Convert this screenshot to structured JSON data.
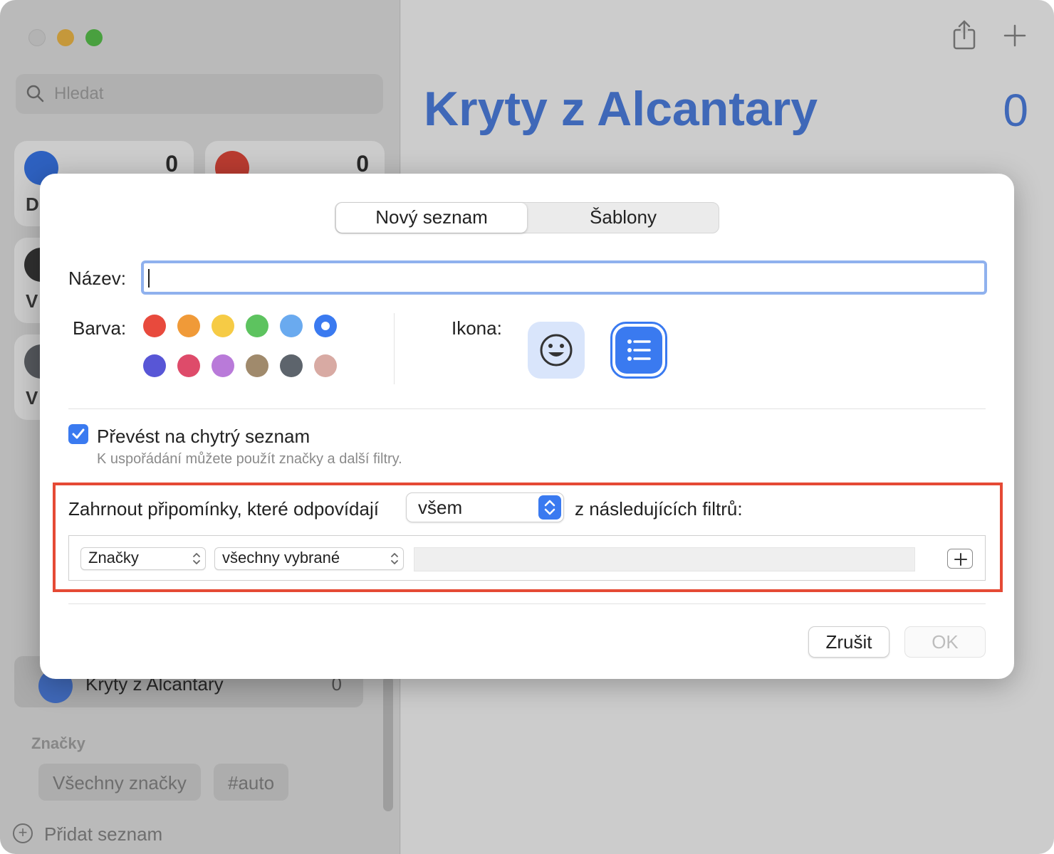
{
  "sidebar": {
    "search_placeholder": "Hledat",
    "tiles": [
      {
        "label": "D",
        "count": "0",
        "icon": "calendar-today-icon"
      },
      {
        "label": "",
        "count": "0",
        "icon": "calendar-scheduled-icon"
      },
      {
        "label": "V",
        "count": "",
        "icon": "tray-all-icon"
      },
      {
        "label": "V",
        "count": "",
        "icon": "checkmark-completed-icon"
      }
    ],
    "selected_list": {
      "label": "Kryty z Alcantary",
      "count": "0",
      "icon": "list-icon"
    },
    "tags_header": "Značky",
    "tags": [
      "Všechny značky",
      "#auto"
    ],
    "add_list_label": "Přidat seznam"
  },
  "main": {
    "title": "Kryty z Alcantary",
    "count": "0"
  },
  "dialog": {
    "tabs": [
      "Nový seznam",
      "Šablony"
    ],
    "active_tab": "Nový seznam",
    "name_label": "Název:",
    "name_value": "",
    "color_label": "Barva:",
    "colors": [
      "#e84a3d",
      "#f09a38",
      "#f6cb45",
      "#5dc35f",
      "#6aaaef",
      "#3a7af0",
      "#5856d6",
      "#de4b6a",
      "#b97ad9",
      "#a08a6c",
      "#5d646c",
      "#d8aaa3"
    ],
    "selected_color": "#3a7af0",
    "icon_label": "Ikona:",
    "smart_checkbox_label": "Převést na chytrý seznam",
    "smart_checkbox_checked": true,
    "smart_subtext": "K uspořádání můžete použít značky a další filtry.",
    "include_prefix": "Zahrnout připomínky, které odpovídají",
    "match_value": "všem",
    "include_suffix": "z následujících filtrů:",
    "filter_type": "Značky",
    "filter_mode": "všechny vybrané",
    "cancel_label": "Zrušit",
    "ok_label": "OK"
  },
  "colors": {
    "accent": "#3a7af0",
    "highlight": "#e54a35",
    "title_blue": "#4f82e6"
  }
}
